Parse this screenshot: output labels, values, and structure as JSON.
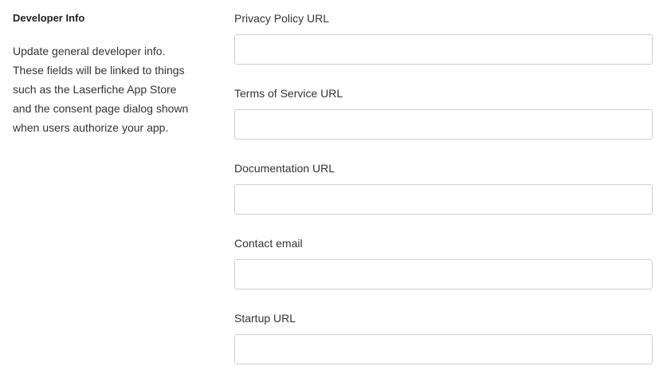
{
  "section": {
    "title": "Developer Info",
    "description": "Update general developer info. These fields will be linked to things such as the Laserfiche App Store and the consent page dialog shown when users authorize your app."
  },
  "fields": [
    {
      "label": "Privacy Policy URL",
      "value": "",
      "placeholder": ""
    },
    {
      "label": "Terms of Service URL",
      "value": "",
      "placeholder": ""
    },
    {
      "label": "Documentation URL",
      "value": "",
      "placeholder": ""
    },
    {
      "label": "Contact email",
      "value": "",
      "placeholder": ""
    },
    {
      "label": "Startup URL",
      "value": "",
      "placeholder": ""
    }
  ]
}
